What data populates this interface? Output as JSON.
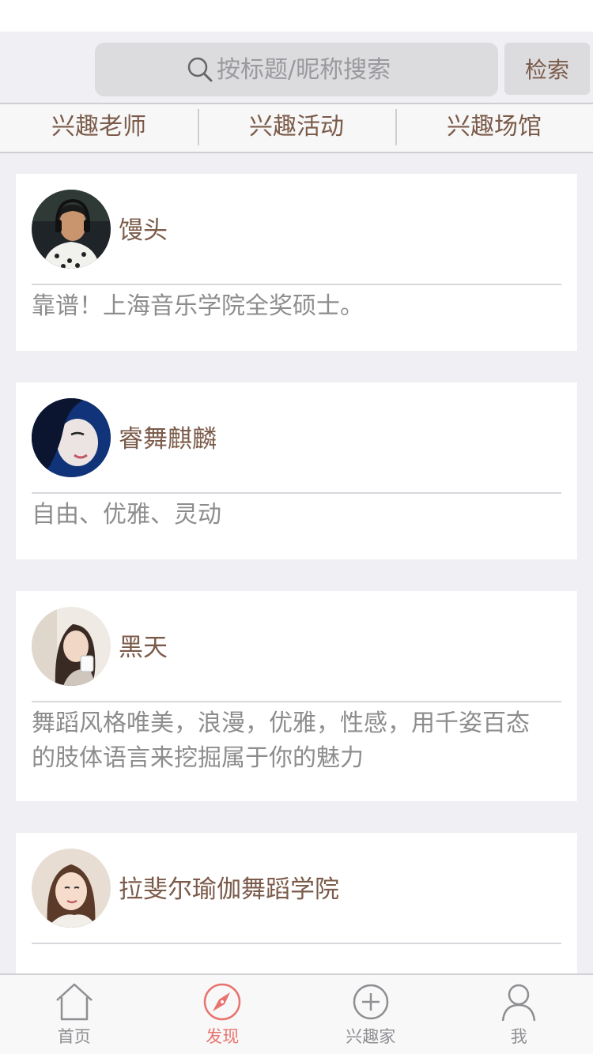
{
  "search": {
    "placeholder": "按标题/昵称搜索",
    "button_label": "检索"
  },
  "tabs": [
    {
      "label": "兴趣老师"
    },
    {
      "label": "兴趣活动"
    },
    {
      "label": "兴趣场馆"
    }
  ],
  "cards": [
    {
      "name": "馒头",
      "description": "靠谱！上海音乐学院全奖硕士。",
      "avatar_icon": "avatar-man-headphones"
    },
    {
      "name": "睿舞麒麟",
      "description": "自由、优雅、灵动",
      "avatar_icon": "avatar-woman-blue"
    },
    {
      "name": "黑天",
      "description": "舞蹈风格唯美，浪漫，优雅，性感，用千姿百态的肢体语言来挖掘属于你的魅力",
      "avatar_icon": "avatar-woman-cup"
    },
    {
      "name": "拉斐尔瑜伽舞蹈学院",
      "description": "",
      "avatar_icon": "avatar-woman-portrait"
    }
  ],
  "tabbar": {
    "items": [
      {
        "label": "首页",
        "icon": "home-icon"
      },
      {
        "label": "发现",
        "icon": "compass-icon",
        "active": true
      },
      {
        "label": "兴趣家",
        "icon": "plus-circle-icon"
      },
      {
        "label": "我",
        "icon": "person-icon"
      }
    ]
  },
  "colors": {
    "accent": "#e8736f",
    "brown_text": "#7b5b4a",
    "background": "#efeff4"
  }
}
